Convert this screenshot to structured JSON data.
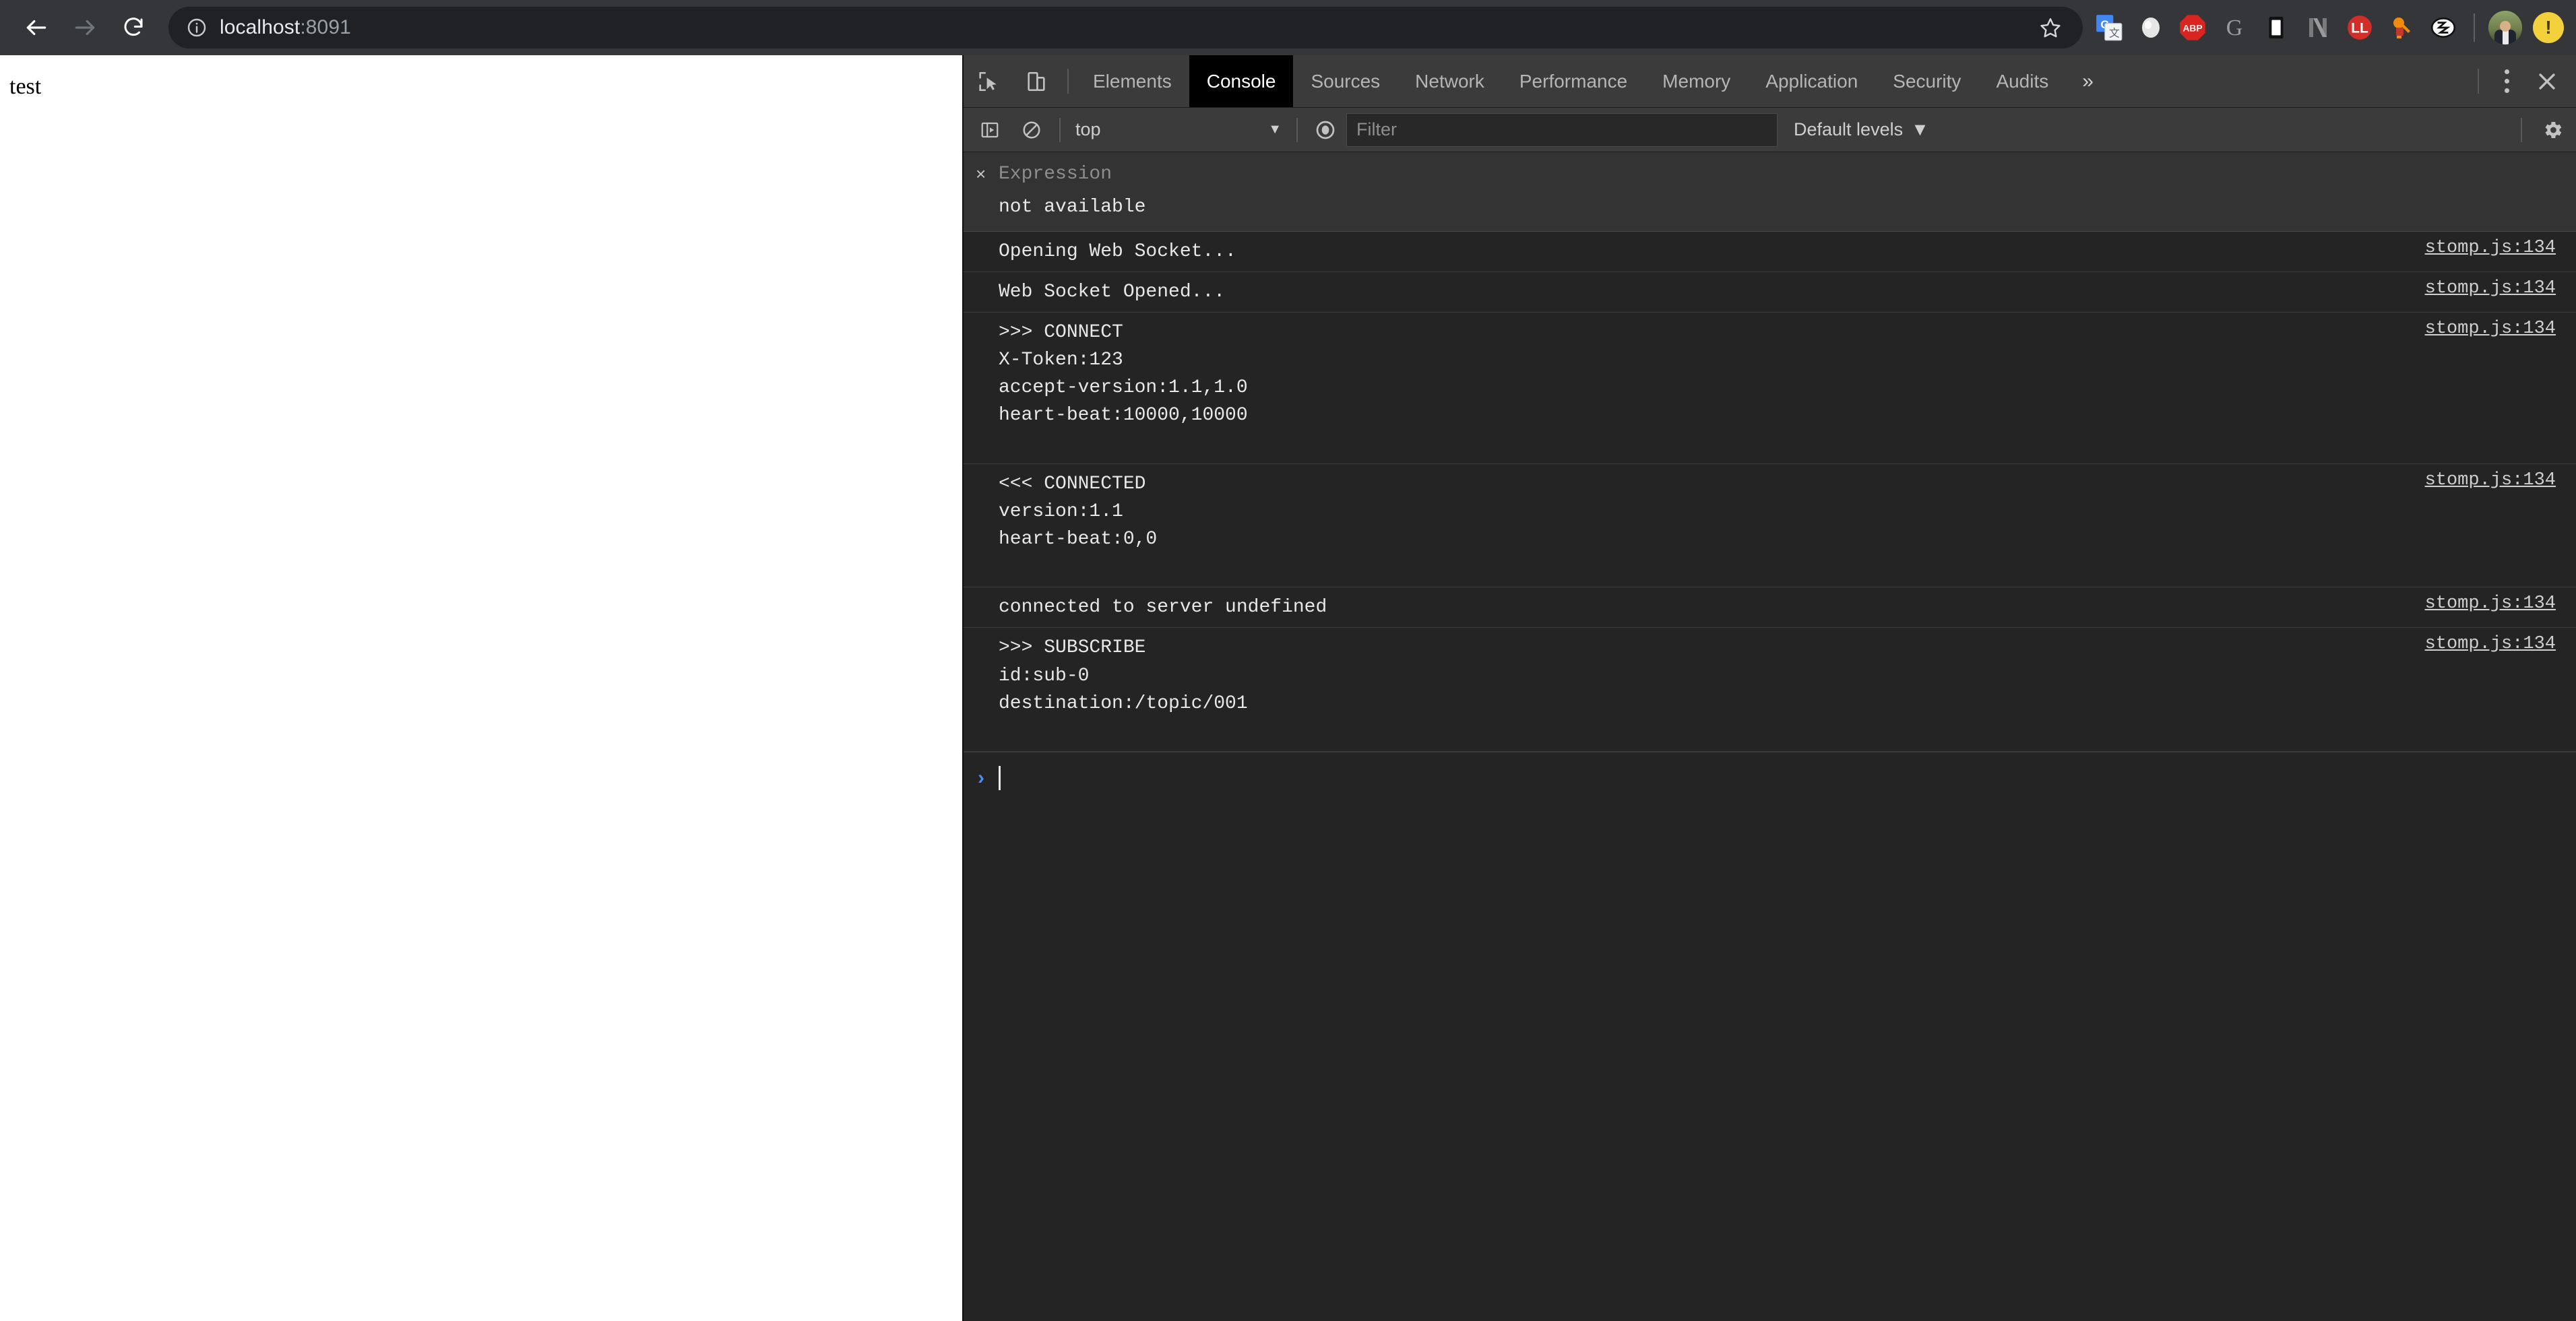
{
  "browser": {
    "back_icon": "arrow-left-icon",
    "forward_icon": "arrow-right-icon",
    "reload_icon": "reload-icon",
    "site_info_icon": "info-circle-icon",
    "url_host": "localhost",
    "url_port": ":8091",
    "url_full": "localhost:8091",
    "bookmark_icon": "star-icon",
    "extensions": [
      {
        "name": "google-translate-icon",
        "label": "G"
      },
      {
        "name": "silver-blob-extension-icon",
        "label": ""
      },
      {
        "name": "adblock-plus-icon",
        "label": "ABP"
      },
      {
        "name": "google-icon",
        "label": "G"
      },
      {
        "name": "mobile-device-icon",
        "label": ""
      },
      {
        "name": "netflix-icon",
        "label": "N"
      },
      {
        "name": "lastpass-icon",
        "label": "LL"
      },
      {
        "name": "orange-key-icon",
        "label": ""
      },
      {
        "name": "hexagon-logo-icon",
        "label": ""
      }
    ],
    "avatar_name": "profile-avatar",
    "warning_badge": "!"
  },
  "page": {
    "body_text": "test"
  },
  "devtools": {
    "inspect_icon": "inspect-element-icon",
    "device_icon": "device-toolbar-icon",
    "tabs": [
      {
        "label": "Elements",
        "selected": false
      },
      {
        "label": "Console",
        "selected": true
      },
      {
        "label": "Sources",
        "selected": false
      },
      {
        "label": "Network",
        "selected": false
      },
      {
        "label": "Performance",
        "selected": false
      },
      {
        "label": "Memory",
        "selected": false
      },
      {
        "label": "Application",
        "selected": false
      },
      {
        "label": "Security",
        "selected": false
      },
      {
        "label": "Audits",
        "selected": false
      }
    ],
    "more_tabs_icon": "»",
    "kebab_icon": "vertical-dots-icon",
    "close_icon": "close-icon",
    "toolbar": {
      "sidebar_toggle_icon": "console-sidebar-icon",
      "clear_console_icon": "clear-console-icon",
      "context_value": "top",
      "context_caret": "▼",
      "live_expression_icon": "eye-icon",
      "filter_placeholder": "Filter",
      "filter_value": "",
      "levels_label": "Default levels",
      "levels_caret": "▼",
      "settings_icon": "gear-icon"
    },
    "live_expression": {
      "close_icon": "×",
      "placeholder": "Expression",
      "value": "not available"
    },
    "messages": [
      {
        "text": "Opening Web Socket...",
        "source": "stomp.js:134"
      },
      {
        "text": "Web Socket Opened...",
        "source": "stomp.js:134"
      },
      {
        "text": ">>> CONNECT\nX-Token:123\naccept-version:1.1,1.0\nheart-beat:10000,10000\n\n",
        "source": "stomp.js:134"
      },
      {
        "text": "<<< CONNECTED\nversion:1.1\nheart-beat:0,0\n\n",
        "source": "stomp.js:134"
      },
      {
        "text": "connected to server undefined",
        "source": "stomp.js:134"
      },
      {
        "text": ">>> SUBSCRIBE\nid:sub-0\ndestination:/topic/001\n\n",
        "source": "stomp.js:134"
      }
    ],
    "prompt": {
      "chevron": "›",
      "value": ""
    }
  }
}
